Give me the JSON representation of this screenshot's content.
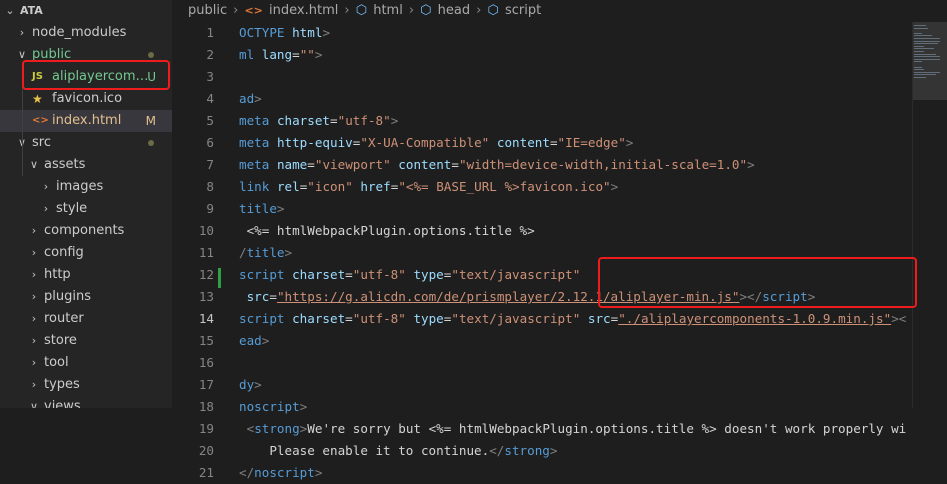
{
  "explorer": {
    "root_label": "ATA",
    "items": [
      {
        "label": "node_modules",
        "kind": "folder",
        "state": "collapsed"
      },
      {
        "label": "public",
        "kind": "folder",
        "state": "expanded",
        "status": "dot",
        "color": "#73c991"
      },
      {
        "label": "aliplayercompo...",
        "kind": "js",
        "status_text": "U",
        "color": "#73c991",
        "icon": "JS"
      },
      {
        "label": "favicon.ico",
        "kind": "star",
        "color": "#cccccc"
      },
      {
        "label": "index.html",
        "kind": "html",
        "status_text": "M",
        "color": "#e2c08d",
        "icon": "<>"
      },
      {
        "label": "src",
        "kind": "folder",
        "state": "expanded",
        "status": "dot"
      },
      {
        "label": "assets",
        "kind": "folder",
        "state": "expanded"
      },
      {
        "label": "images",
        "kind": "folder",
        "state": "collapsed"
      },
      {
        "label": "style",
        "kind": "folder",
        "state": "collapsed"
      },
      {
        "label": "components",
        "kind": "folder",
        "state": "collapsed"
      },
      {
        "label": "config",
        "kind": "folder",
        "state": "collapsed"
      },
      {
        "label": "http",
        "kind": "folder",
        "state": "collapsed"
      },
      {
        "label": "plugins",
        "kind": "folder",
        "state": "collapsed"
      },
      {
        "label": "router",
        "kind": "folder",
        "state": "collapsed"
      },
      {
        "label": "store",
        "kind": "folder",
        "state": "collapsed"
      },
      {
        "label": "tool",
        "kind": "folder",
        "state": "collapsed"
      },
      {
        "label": "types",
        "kind": "folder",
        "state": "collapsed"
      },
      {
        "label": "views",
        "kind": "folder",
        "state": "expanded"
      }
    ]
  },
  "breadcrumb": {
    "parts": [
      "public",
      "index.html",
      "html",
      "head",
      "script"
    ],
    "icons": [
      "html-file-icon",
      "element-icon",
      "element-icon",
      "element-icon"
    ]
  },
  "editor": {
    "active_line": 14,
    "lines": [
      {
        "n": "1",
        "tokens": [
          [
            "t-tag",
            "OCTYPE"
          ],
          [
            "t-txt",
            " "
          ],
          [
            "t-attr",
            "html"
          ],
          [
            "t-bracket",
            ">"
          ]
        ]
      },
      {
        "n": "2",
        "tokens": [
          [
            "t-tag",
            "ml"
          ],
          [
            "t-txt",
            " "
          ],
          [
            "t-attr",
            "lang"
          ],
          [
            "t-txt",
            "="
          ],
          [
            "t-str",
            "\"\""
          ],
          [
            "t-bracket",
            ">"
          ]
        ]
      },
      {
        "n": "3",
        "tokens": []
      },
      {
        "n": "4",
        "tokens": [
          [
            "t-tag",
            "ad"
          ],
          [
            "t-bracket",
            ">"
          ]
        ]
      },
      {
        "n": "5",
        "tokens": [
          [
            "t-tag",
            "meta"
          ],
          [
            "t-txt",
            " "
          ],
          [
            "t-attr",
            "charset"
          ],
          [
            "t-txt",
            "="
          ],
          [
            "t-str",
            "\"utf-8\""
          ],
          [
            "t-bracket",
            ">"
          ]
        ]
      },
      {
        "n": "6",
        "tokens": [
          [
            "t-tag",
            "meta"
          ],
          [
            "t-txt",
            " "
          ],
          [
            "t-attr",
            "http-equiv"
          ],
          [
            "t-txt",
            "="
          ],
          [
            "t-str",
            "\"X-UA-Compatible\""
          ],
          [
            "t-txt",
            " "
          ],
          [
            "t-attr",
            "content"
          ],
          [
            "t-txt",
            "="
          ],
          [
            "t-str",
            "\"IE=edge\""
          ],
          [
            "t-bracket",
            ">"
          ]
        ]
      },
      {
        "n": "7",
        "tokens": [
          [
            "t-tag",
            "meta"
          ],
          [
            "t-txt",
            " "
          ],
          [
            "t-attr",
            "name"
          ],
          [
            "t-txt",
            "="
          ],
          [
            "t-str",
            "\"viewport\""
          ],
          [
            "t-txt",
            " "
          ],
          [
            "t-attr",
            "content"
          ],
          [
            "t-txt",
            "="
          ],
          [
            "t-str",
            "\"width=device-width,initial-scale=1.0\""
          ],
          [
            "t-bracket",
            ">"
          ]
        ]
      },
      {
        "n": "8",
        "tokens": [
          [
            "t-tag",
            "link"
          ],
          [
            "t-txt",
            " "
          ],
          [
            "t-attr",
            "rel"
          ],
          [
            "t-txt",
            "="
          ],
          [
            "t-str",
            "\"icon\""
          ],
          [
            "t-txt",
            " "
          ],
          [
            "t-attr",
            "href"
          ],
          [
            "t-txt",
            "="
          ],
          [
            "t-str",
            "\"<%= BASE_URL %>favicon.ico\""
          ],
          [
            "t-bracket",
            ">"
          ]
        ]
      },
      {
        "n": "9",
        "tokens": [
          [
            "t-tag",
            "title"
          ],
          [
            "t-bracket",
            ">"
          ]
        ]
      },
      {
        "n": "10",
        "tokens": [
          [
            "t-txt",
            " <%= htmlWebpackPlugin.options.title %>"
          ]
        ]
      },
      {
        "n": "11",
        "tokens": [
          [
            "t-bracket",
            "/"
          ],
          [
            "t-tag",
            "title"
          ],
          [
            "t-bracket",
            ">"
          ]
        ]
      },
      {
        "n": "12",
        "tokens": [
          [
            "t-tag",
            "script"
          ],
          [
            "t-txt",
            " "
          ],
          [
            "t-attr",
            "charset"
          ],
          [
            "t-txt",
            "="
          ],
          [
            "t-str",
            "\"utf-8\""
          ],
          [
            "t-txt",
            " "
          ],
          [
            "t-attr",
            "type"
          ],
          [
            "t-txt",
            "="
          ],
          [
            "t-str",
            "\"text/javascript\""
          ]
        ]
      },
      {
        "n": "13",
        "tokens": [
          [
            "t-txt",
            " "
          ],
          [
            "t-attr",
            "src"
          ],
          [
            "t-txt",
            "="
          ],
          [
            "t-str",
            "\"https://g.alicdn.com/de/prismplayer/2.12.1/aliplayer-min.js\""
          ],
          [
            "t-bracket",
            "></"
          ],
          [
            "t-tag",
            "script"
          ],
          [
            "t-bracket",
            ">"
          ]
        ]
      },
      {
        "n": "14",
        "tokens": [
          [
            "t-tag",
            "script"
          ],
          [
            "t-txt",
            " "
          ],
          [
            "t-attr",
            "charset"
          ],
          [
            "t-txt",
            "="
          ],
          [
            "t-str",
            "\"utf-8\""
          ],
          [
            "t-txt",
            " "
          ],
          [
            "t-attr",
            "type"
          ],
          [
            "t-txt",
            "="
          ],
          [
            "t-str",
            "\"text/javascript\""
          ],
          [
            "t-txt",
            " "
          ],
          [
            "t-attr",
            "src"
          ],
          [
            "t-txt",
            "="
          ],
          [
            "t-str",
            "\"./aliplayercomponents-1.0.9.min.js\""
          ],
          [
            "t-bracket",
            "><"
          ]
        ]
      },
      {
        "n": "15",
        "tokens": [
          [
            "t-tag",
            "ead"
          ],
          [
            "t-bracket",
            ">"
          ]
        ]
      },
      {
        "n": "16",
        "tokens": []
      },
      {
        "n": "17",
        "tokens": [
          [
            "t-tag",
            "dy"
          ],
          [
            "t-bracket",
            ">"
          ]
        ]
      },
      {
        "n": "18",
        "tokens": [
          [
            "t-tag",
            "noscript"
          ],
          [
            "t-bracket",
            ">"
          ]
        ]
      },
      {
        "n": "19",
        "tokens": [
          [
            "t-txt",
            " "
          ],
          [
            "t-bracket",
            "<"
          ],
          [
            "t-tag",
            "strong"
          ],
          [
            "t-bracket",
            ">"
          ],
          [
            "t-txt",
            "We're sorry but <%= htmlWebpackPlugin.options.title %> doesn't work properly wi"
          ]
        ]
      },
      {
        "n": "20",
        "tokens": [
          [
            "t-txt",
            "    Please enable it to continue."
          ],
          [
            "t-bracket",
            "</"
          ],
          [
            "t-tag",
            "strong"
          ],
          [
            "t-bracket",
            ">"
          ]
        ]
      },
      {
        "n": "21",
        "tokens": [
          [
            "t-bracket",
            "</"
          ],
          [
            "t-tag",
            "noscript"
          ],
          [
            "t-bracket",
            ">"
          ]
        ]
      }
    ]
  }
}
